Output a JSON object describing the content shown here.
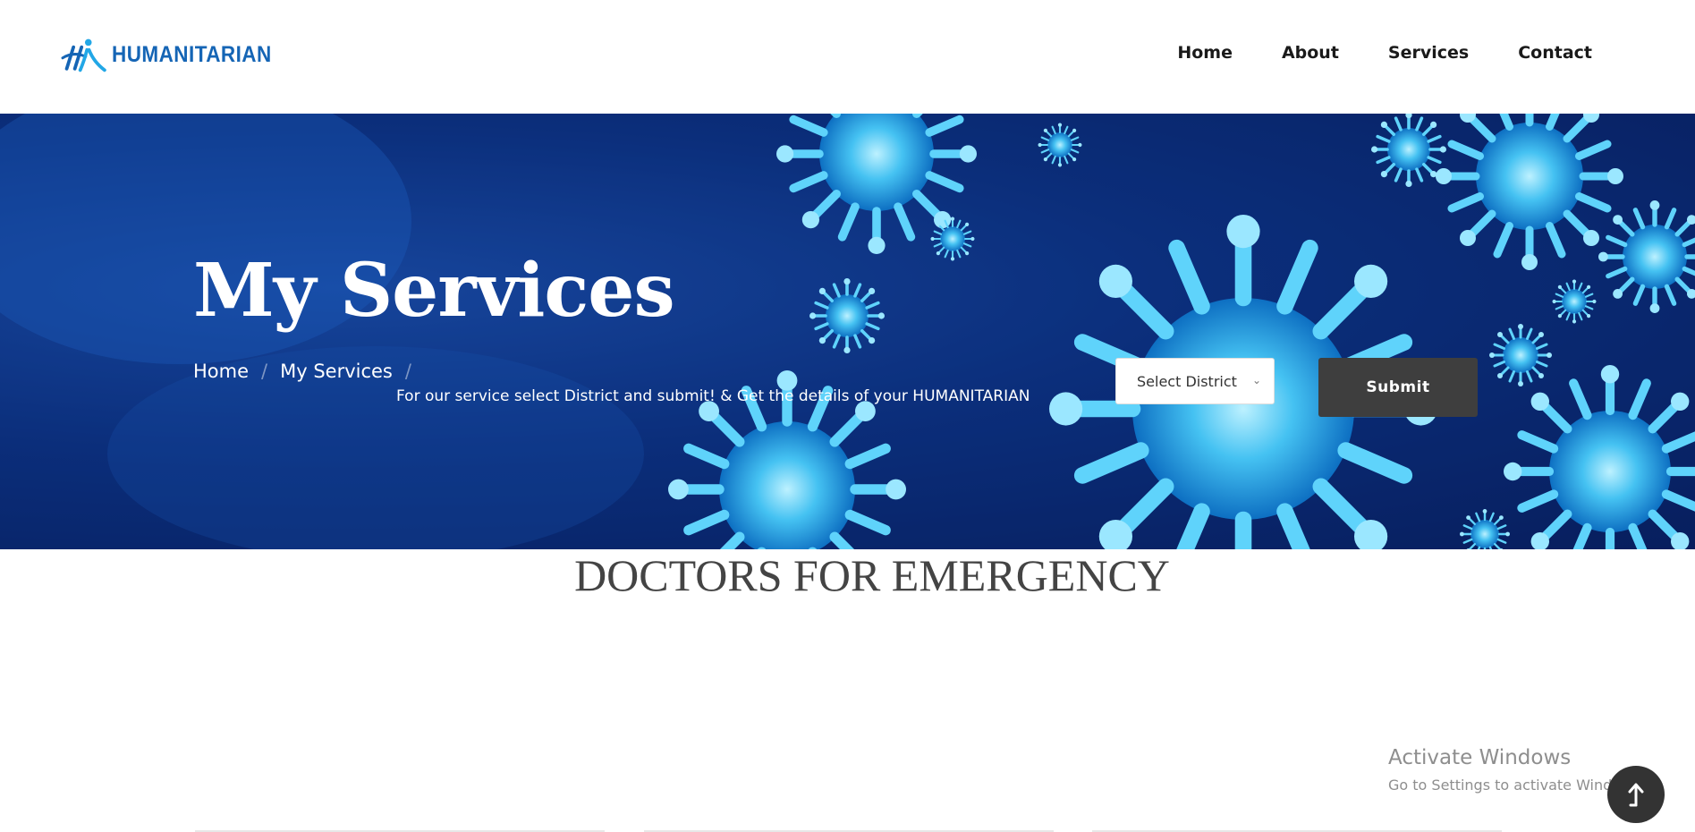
{
  "brand": {
    "name": "HUMANITARIAN",
    "logo_icon": "humanitarian-logo-mark"
  },
  "nav": {
    "items": [
      {
        "label": "Home"
      },
      {
        "label": "About"
      },
      {
        "label": "Services"
      },
      {
        "label": "Contact"
      }
    ]
  },
  "hero": {
    "title": "My Services",
    "breadcrumb": {
      "home": "Home",
      "current": "My Services",
      "separator": "/"
    },
    "hint": "For our service select District and submit! & Get the details of your HUMANITARIAN",
    "district_select": {
      "selected": "Select District",
      "icon": "chevron-down-icon"
    },
    "submit_label": "Submit"
  },
  "section": {
    "title": "DOCTORS FOR EMERGENCY"
  },
  "watermark": {
    "line1": "Activate Windows",
    "line2": "Go to Settings to activate Windows."
  },
  "scroll_top": {
    "icon": "arrow-up-icon"
  },
  "colors": {
    "brand_blue": "#1565b5",
    "logo_light_blue": "#22a7e6",
    "submit_bg": "#3e3e3e",
    "hero_dark": "#061a55"
  }
}
